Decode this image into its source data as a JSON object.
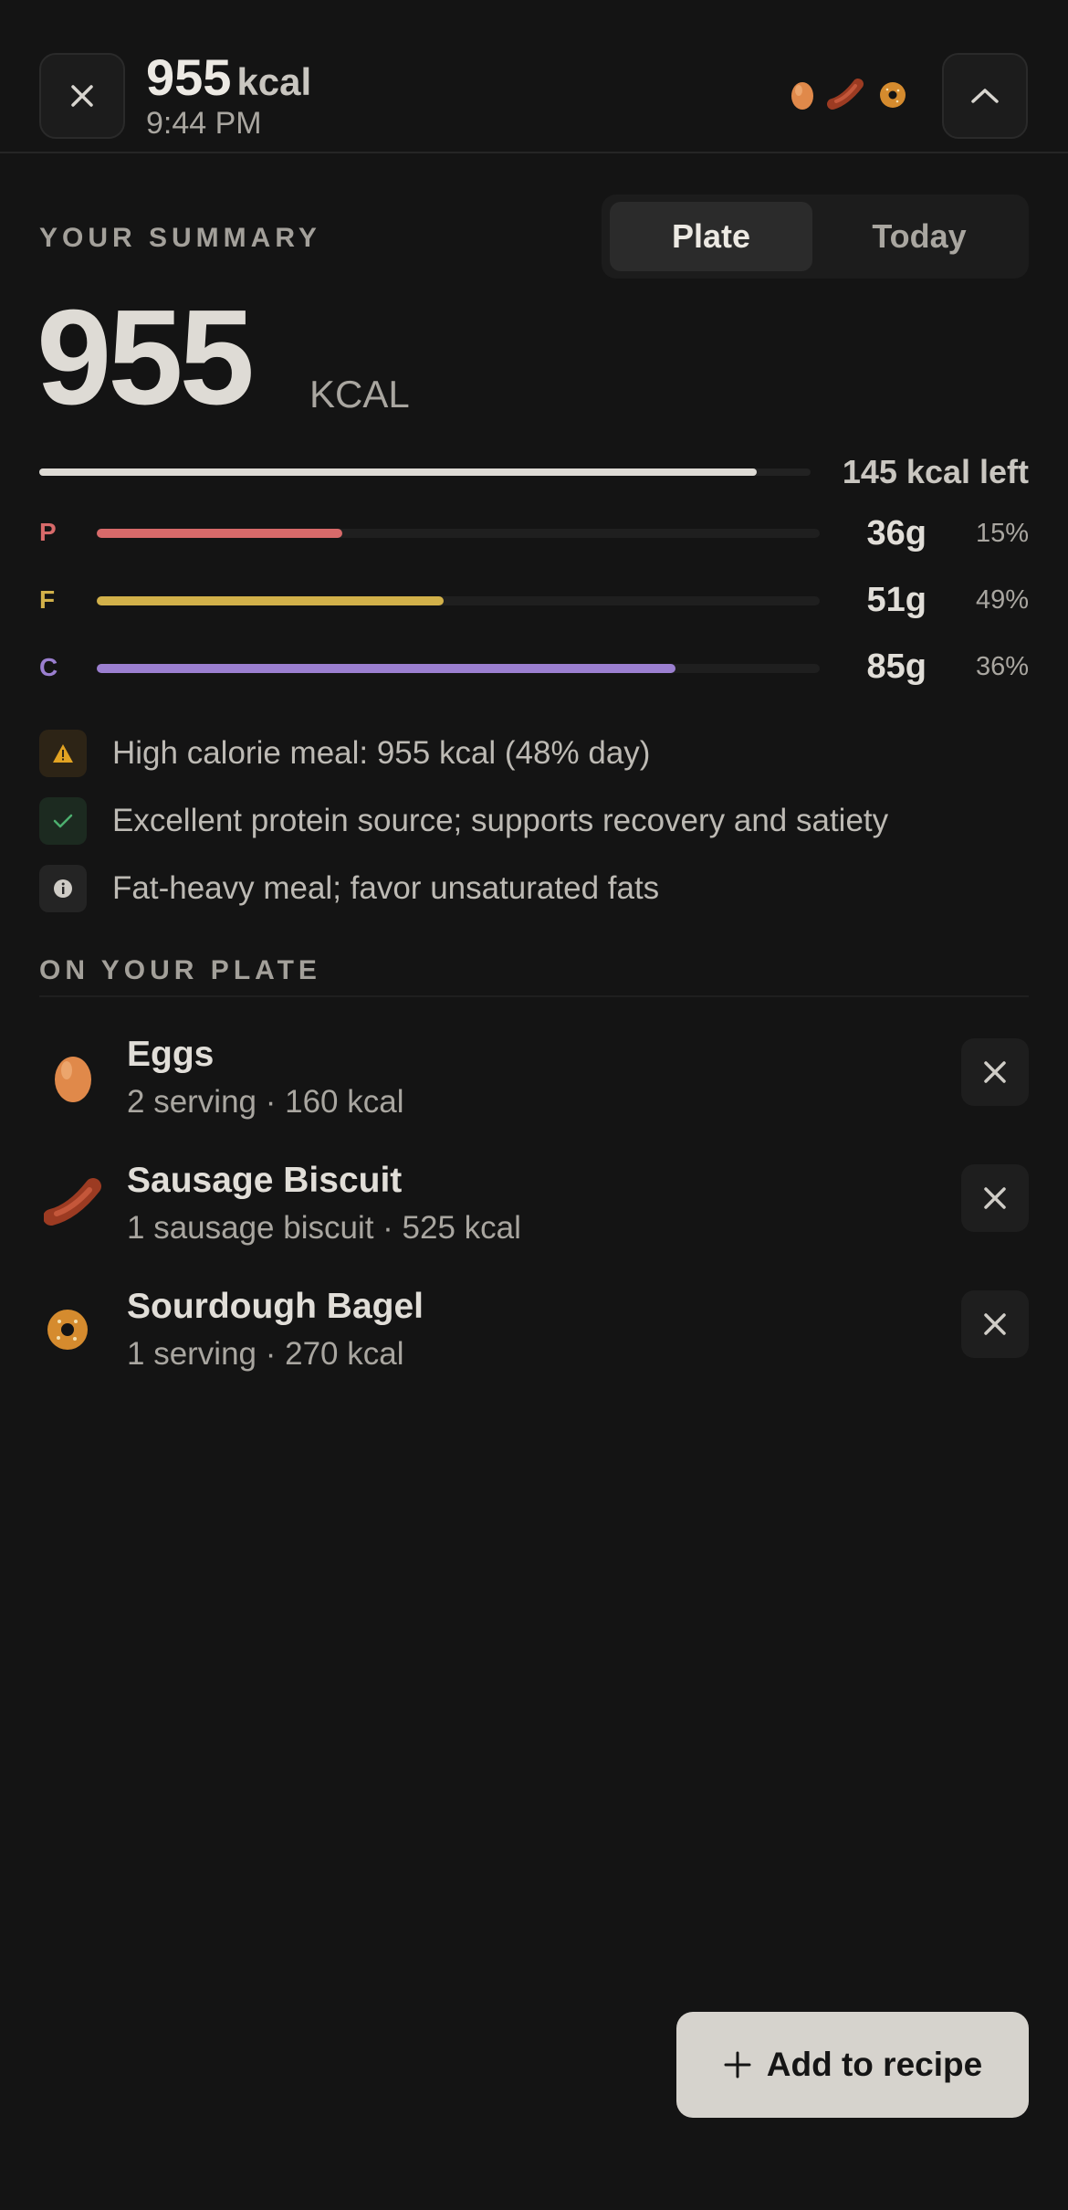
{
  "header": {
    "kcal": "955",
    "kcal_unit": "kcal",
    "time": "9:44 PM",
    "thumbnails": [
      "egg-icon",
      "sausage-icon",
      "bagel-icon"
    ]
  },
  "summary": {
    "label": "YOUR SUMMARY",
    "tabs": [
      {
        "label": "Plate",
        "selected": true
      },
      {
        "label": "Today",
        "selected": false
      }
    ],
    "kcal": "955",
    "kcal_unit": "KCAL",
    "kcal_left": "145 kcal left",
    "calorie_progress": 0.93
  },
  "macros": [
    {
      "letter": "P",
      "grams": "36g",
      "percent": "15%",
      "fill": 0.34,
      "color": "#d86a6a"
    },
    {
      "letter": "F",
      "grams": "51g",
      "percent": "49%",
      "fill": 0.48,
      "color": "#d2b14a"
    },
    {
      "letter": "C",
      "grams": "85g",
      "percent": "36%",
      "fill": 0.8,
      "color": "#9b7fd0"
    }
  ],
  "insights": [
    {
      "icon": "warning-icon",
      "text": "High calorie meal: 955 kcal (48% day)",
      "color": "#e2a322"
    },
    {
      "icon": "check-icon",
      "text": "Excellent protein source; supports recovery and satiety",
      "color": "#4caf6e"
    },
    {
      "icon": "info-icon",
      "text": "Fat-heavy meal; favor unsaturated fats",
      "color": "#bdbab4"
    }
  ],
  "plate": {
    "label": "ON YOUR PLATE",
    "items": [
      {
        "icon": "egg-icon",
        "name": "Eggs",
        "meta": "2 serving · 160 kcal"
      },
      {
        "icon": "sausage-icon",
        "name": "Sausage Biscuit",
        "meta": "1 sausage biscuit · 525 kcal"
      },
      {
        "icon": "bagel-icon",
        "name": "Sourdough Bagel",
        "meta": "1 serving · 270 kcal"
      }
    ]
  },
  "cta": {
    "label": "Add to recipe"
  },
  "colors": {
    "background": "#141414",
    "accent": "#d6d3cd"
  }
}
